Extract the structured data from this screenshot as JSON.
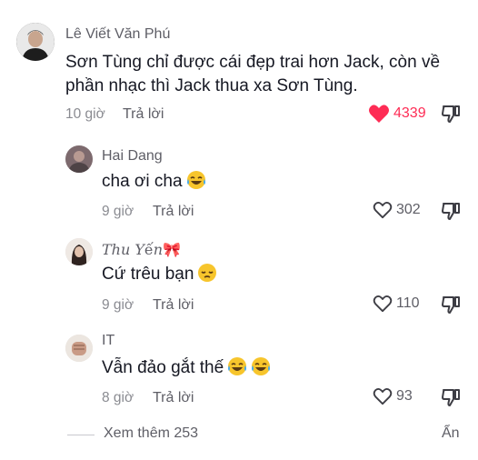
{
  "comments": [
    {
      "author": "Lê Viết Văn Phú",
      "text_line1": "Sơn Tùng chỉ được cái đẹp trai hơn Jack, còn về",
      "text_line2": "phần nhạc thì Jack thua xa Sơn Tùng.",
      "time": "10 giờ",
      "reply": "Trả lời",
      "likes": "4339",
      "liked": true
    }
  ],
  "replies": [
    {
      "author": "Hai Dang",
      "text": "cha ơi cha",
      "emoji": [
        "tears-of-joy-emoji"
      ],
      "time": "9 giờ",
      "reply": "Trả lời",
      "likes": "302"
    },
    {
      "author": "𝑇ℎ𝑢 𝑌ế𝑛🎀",
      "text": "Cứ trêu bạn",
      "emoji": [
        "pensive-face-emoji"
      ],
      "time": "9 giờ",
      "reply": "Trả lời",
      "likes": "110"
    },
    {
      "author": "IT",
      "text": "Vẫn đảo gắt thế",
      "emoji": [
        "tears-of-joy-emoji",
        "tears-of-joy-emoji"
      ],
      "time": "8 giờ",
      "reply": "Trả lời",
      "likes": "93"
    }
  ],
  "footer": {
    "more": "Xem thêm 253",
    "hide": "Ẩn"
  },
  "colors": {
    "like_red": "#fe2c55",
    "text": "#161823",
    "muted": "#8a8b91"
  }
}
